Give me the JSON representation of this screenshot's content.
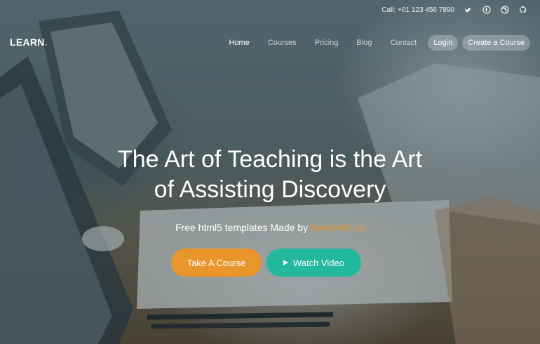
{
  "topbar": {
    "phone": "Call: +01 123 456 7890",
    "social": [
      "twitter-icon",
      "facebook-icon",
      "dribbble-icon",
      "github-icon"
    ]
  },
  "brand": {
    "name": "LEARN",
    "dot": "."
  },
  "nav": {
    "items": [
      {
        "label": "Home",
        "active": true
      },
      {
        "label": "Courses"
      },
      {
        "label": "Pricing"
      },
      {
        "label": "Blog"
      },
      {
        "label": "Contact"
      }
    ],
    "login": "Login",
    "create": "Create a Course"
  },
  "hero": {
    "line1": "The Art of Teaching is the Art",
    "line2": "of Assisting Discovery",
    "sub_prefix": "Free html5 templates Made by ",
    "sub_link": "freehtml5.co",
    "btn_take": "Take A Course",
    "btn_watch": "Watch Video"
  },
  "colors": {
    "accent": "#e8952b",
    "teal": "#21b89b"
  }
}
